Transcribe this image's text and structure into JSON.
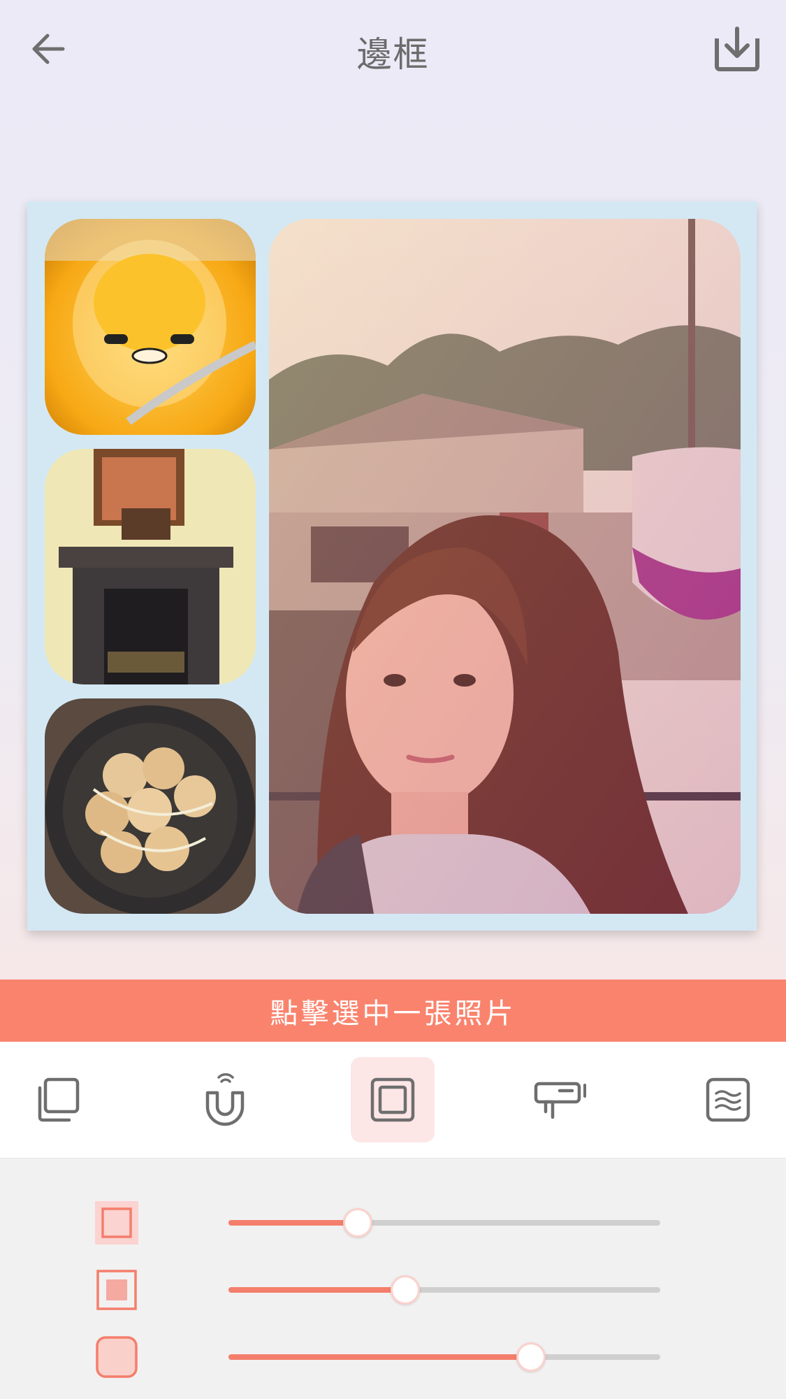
{
  "header": {
    "title": "邊框",
    "back_icon": "arrow-left-icon",
    "save_icon": "download-icon"
  },
  "collage": {
    "background_color": "#d4e8f4",
    "photos": [
      {
        "name": "gudetama-dessert-photo"
      },
      {
        "name": "fireplace-photo"
      },
      {
        "name": "takoyaki-photo"
      },
      {
        "name": "selfie-photo"
      }
    ]
  },
  "banner": {
    "text": "點擊選中一張照片"
  },
  "toolbar": {
    "tools": [
      {
        "icon": "layers-icon",
        "active": false
      },
      {
        "icon": "magnet-icon",
        "active": false
      },
      {
        "icon": "border-frame-icon",
        "active": true
      },
      {
        "icon": "text-bubble-icon",
        "active": false
      },
      {
        "icon": "pattern-icon",
        "active": false
      }
    ]
  },
  "sliders": [
    {
      "icon": "outer-border-icon",
      "selected": true,
      "value": 0.3
    },
    {
      "icon": "inner-border-icon",
      "selected": false,
      "value": 0.41
    },
    {
      "icon": "corner-radius-icon",
      "selected": false,
      "value": 0.7
    }
  ],
  "colors": {
    "accent": "#fa836d",
    "track": "#cfcfcf"
  }
}
